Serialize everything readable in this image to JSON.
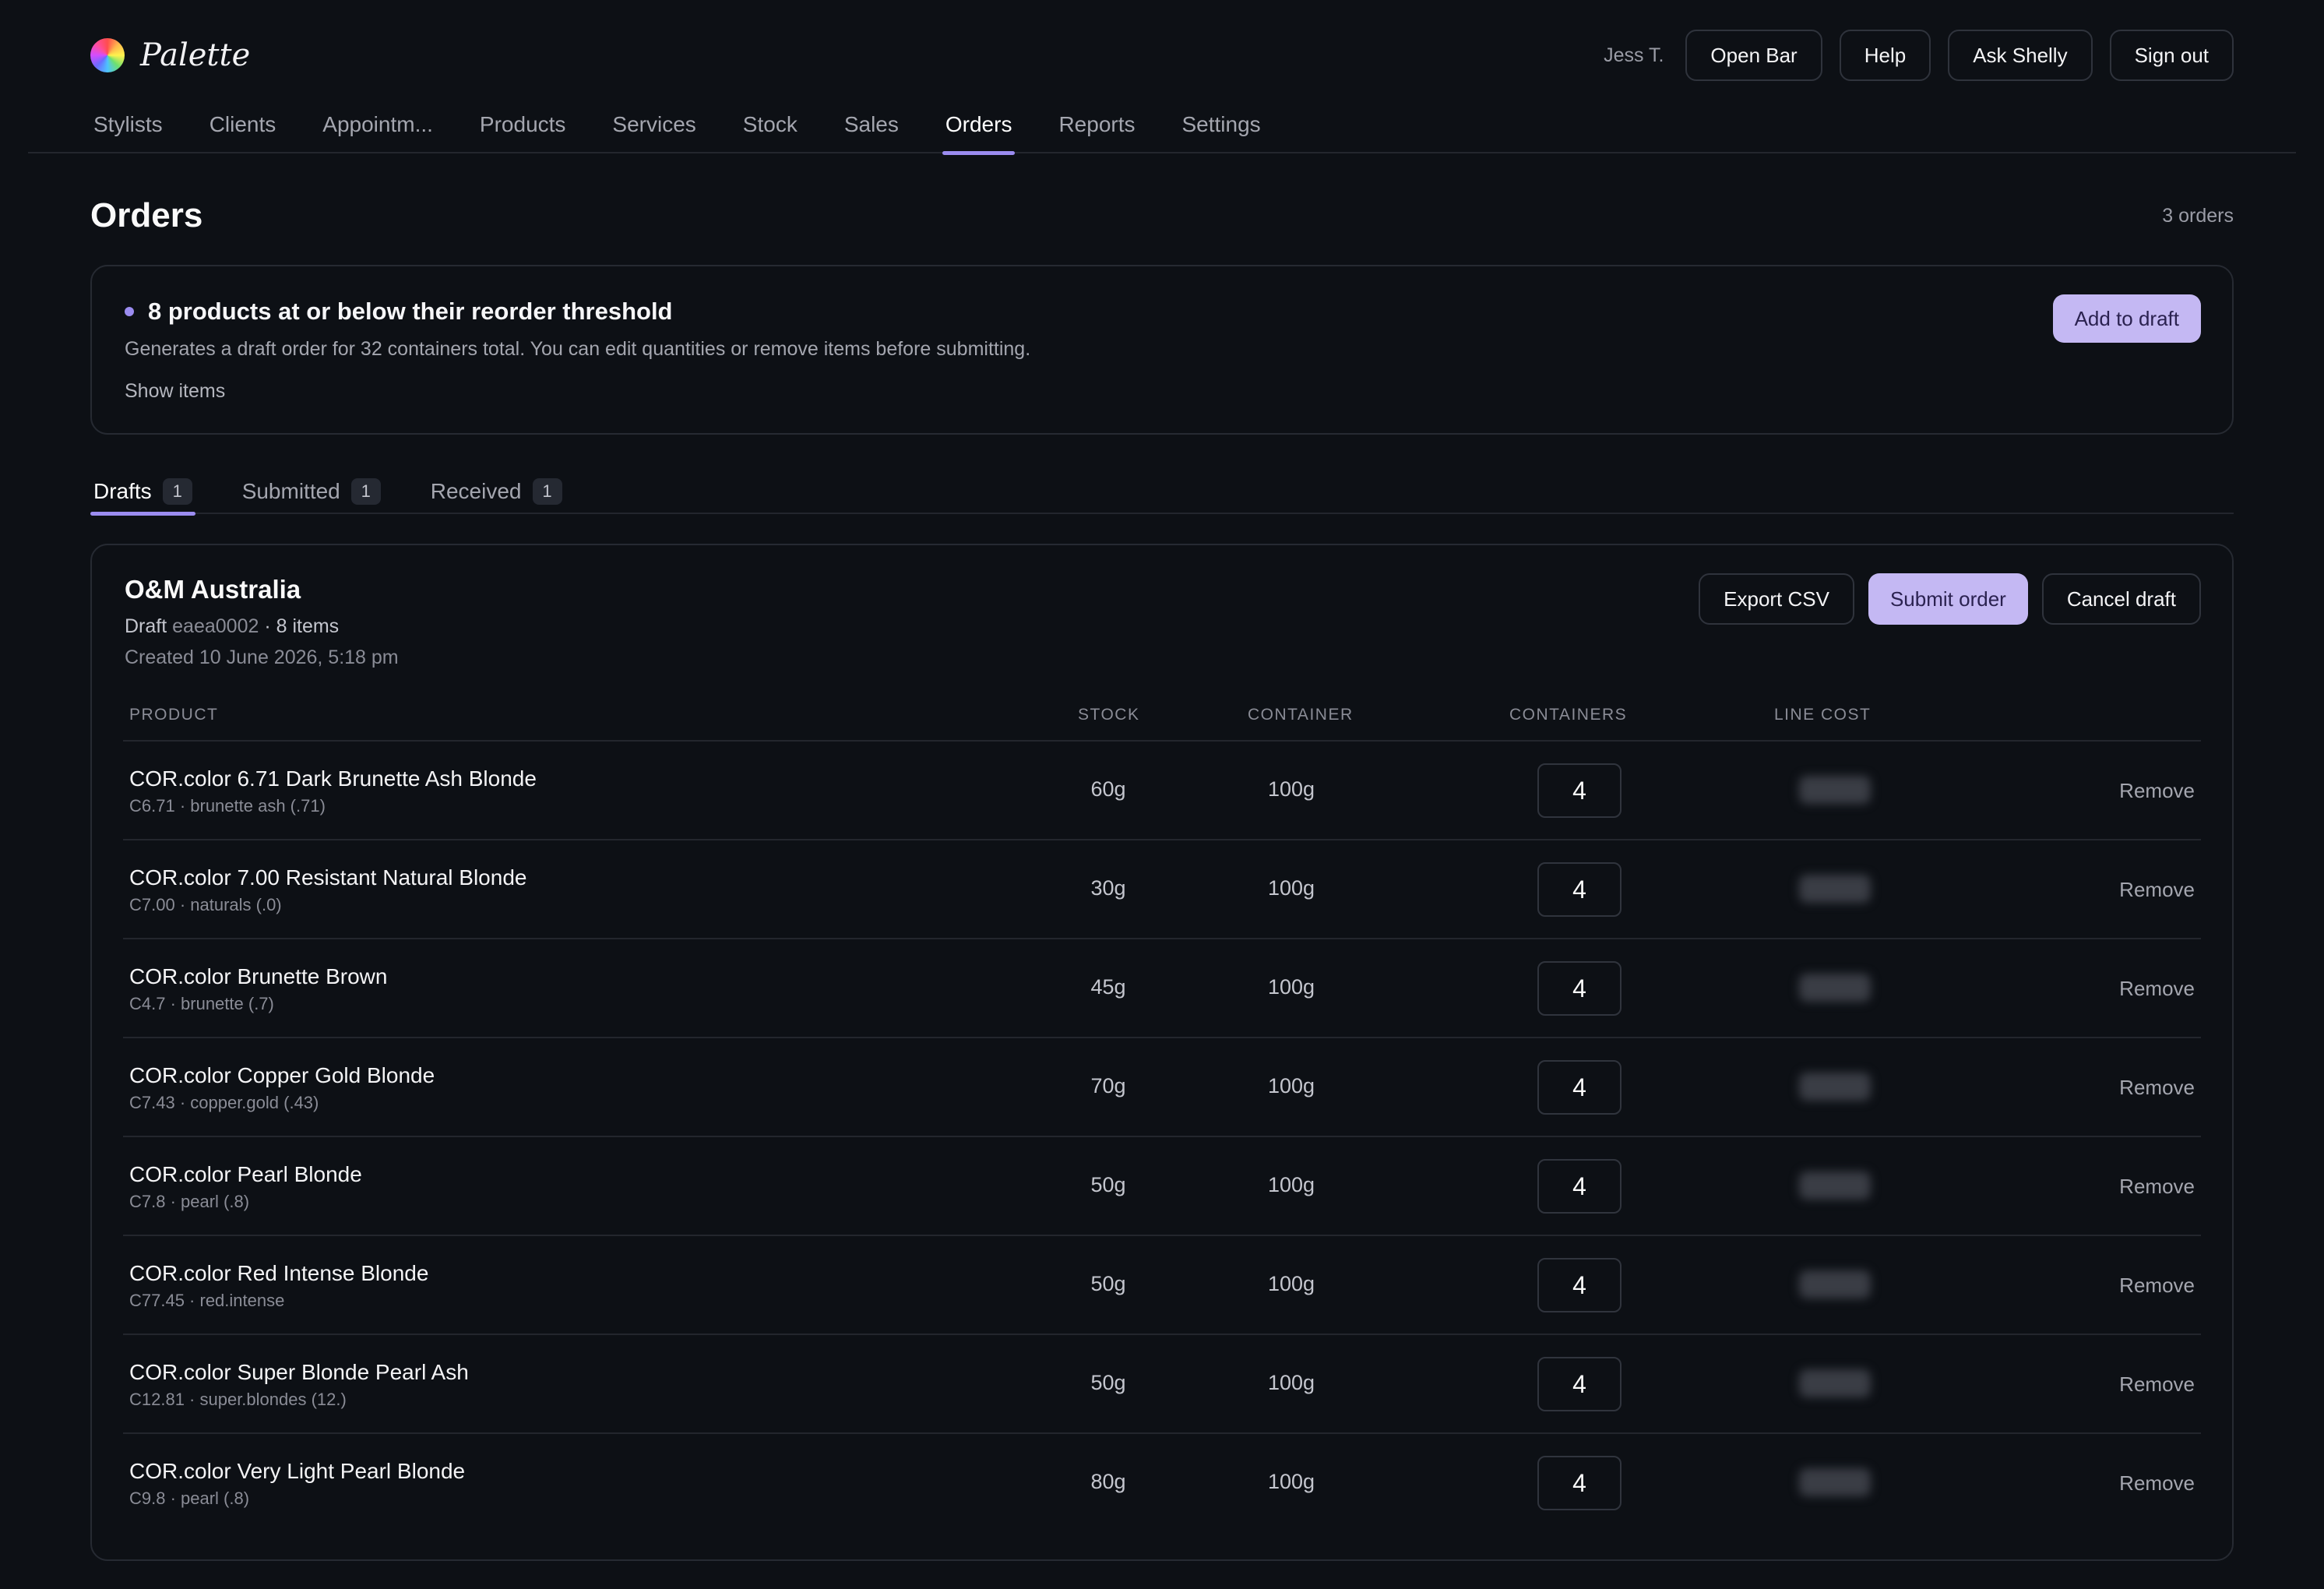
{
  "app": {
    "name": "Palette"
  },
  "header": {
    "user": "Jess T.",
    "buttons": [
      "Open Bar",
      "Help",
      "Ask Shelly",
      "Sign out"
    ]
  },
  "nav": {
    "items": [
      "Stylists",
      "Clients",
      "Appointm...",
      "Products",
      "Services",
      "Stock",
      "Sales",
      "Orders",
      "Reports",
      "Settings"
    ],
    "active": "Orders"
  },
  "page": {
    "title": "Orders",
    "count_label": "3 orders"
  },
  "alert": {
    "title": "8 products at or below their reorder threshold",
    "description": "Generates a draft order for 32 containers total. You can edit quantities or remove items before submitting.",
    "show_items": "Show items",
    "action": "Add to draft"
  },
  "tabs": [
    {
      "label": "Drafts",
      "count": "1"
    },
    {
      "label": "Submitted",
      "count": "1"
    },
    {
      "label": "Received",
      "count": "1"
    }
  ],
  "order": {
    "supplier": "O&M Australia",
    "status": "Draft",
    "id": "eaea0002",
    "items_label": "· 8 items",
    "created": "Created 10 June 2026, 5:18 pm",
    "actions": {
      "export": "Export CSV",
      "submit": "Submit order",
      "cancel": "Cancel draft"
    },
    "columns": [
      "PRODUCT",
      "STOCK",
      "CONTAINER",
      "CONTAINERS",
      "LINE COST"
    ],
    "remove_label": "Remove",
    "rows": [
      {
        "name": "COR.color 6.71 Dark Brunette Ash Blonde",
        "meta": "C6.71 · brunette ash (.71)",
        "stock": "60g",
        "container": "100g",
        "containers": "4"
      },
      {
        "name": "COR.color 7.00 Resistant Natural Blonde",
        "meta": "C7.00 · naturals (.0)",
        "stock": "30g",
        "container": "100g",
        "containers": "4"
      },
      {
        "name": "COR.color Brunette Brown",
        "meta": "C4.7 · brunette (.7)",
        "stock": "45g",
        "container": "100g",
        "containers": "4"
      },
      {
        "name": "COR.color Copper Gold Blonde",
        "meta": "C7.43 · copper.gold (.43)",
        "stock": "70g",
        "container": "100g",
        "containers": "4"
      },
      {
        "name": "COR.color Pearl Blonde",
        "meta": "C7.8 · pearl (.8)",
        "stock": "50g",
        "container": "100g",
        "containers": "4"
      },
      {
        "name": "COR.color Red Intense Blonde",
        "meta": "C77.45 · red.intense",
        "stock": "50g",
        "container": "100g",
        "containers": "4"
      },
      {
        "name": "COR.color Super Blonde Pearl Ash",
        "meta": "C12.81 · super.blondes (12.)",
        "stock": "50g",
        "container": "100g",
        "containers": "4"
      },
      {
        "name": "COR.color Very Light Pearl Blonde",
        "meta": "C9.8 · pearl (.8)",
        "stock": "80g",
        "container": "100g",
        "containers": "4"
      }
    ]
  },
  "colors": {
    "accent": "#c4b8f3",
    "accent_underline": "#9b8cf0",
    "background": "#0d1015"
  }
}
